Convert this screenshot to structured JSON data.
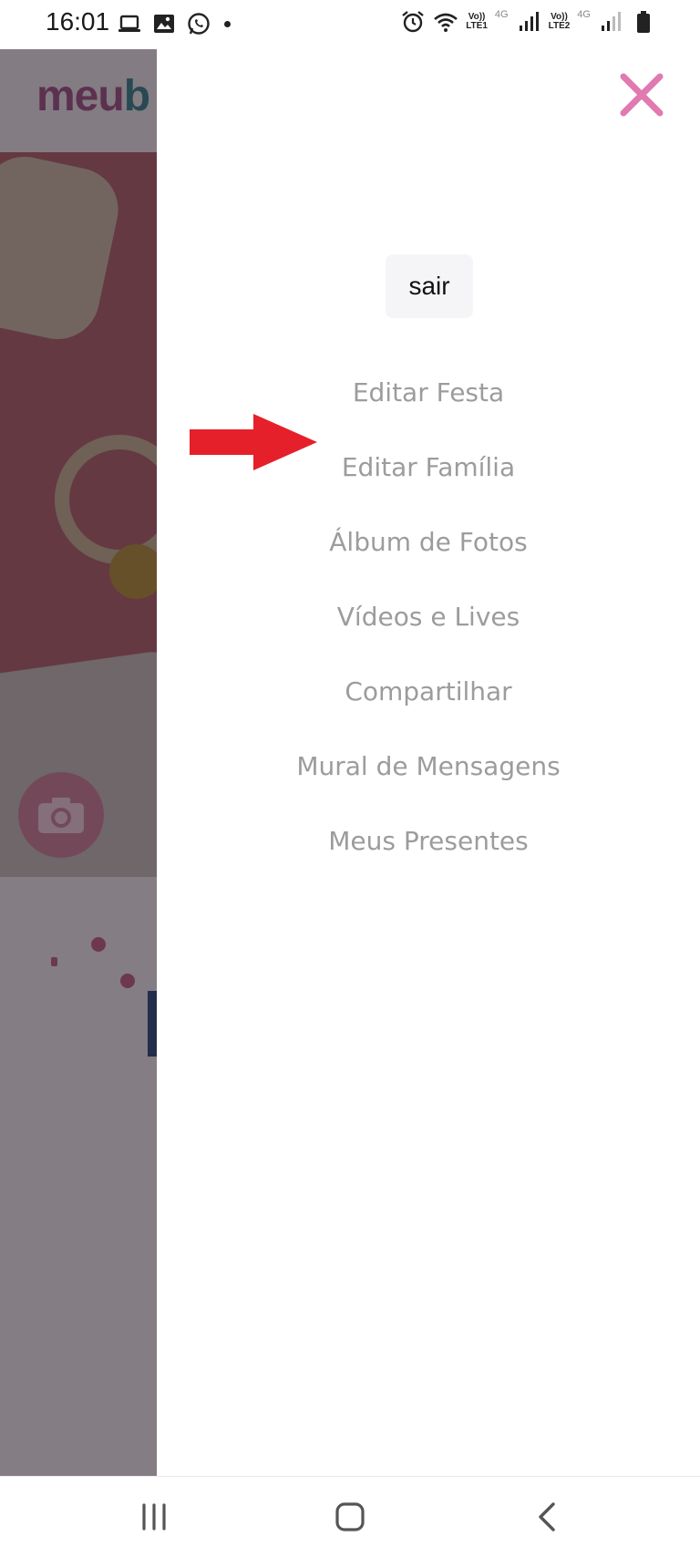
{
  "status_bar": {
    "time": "16:01",
    "sim1_label_top": "Vo))",
    "sim1_label_bottom": "LTE1",
    "sim2_label_top": "Vo))",
    "sim2_label_bottom": "LTE2",
    "network_type_1": "4G",
    "network_type_2": "4G",
    "left_icons": [
      "laptop-icon",
      "gallery-icon",
      "whatsapp-icon",
      "dot-icon"
    ],
    "right_icons": [
      "alarm-icon",
      "wifi-icon",
      "signal-icon",
      "signal-icon",
      "battery-icon"
    ]
  },
  "background_page": {
    "logo_text": "meu",
    "logo_partial": "b",
    "camera_icon": "camera-icon"
  },
  "drawer": {
    "close_icon": "close-icon",
    "close_color": "#e07ab0",
    "logout_label": "sair",
    "menu_items": [
      {
        "label": "Editar Festa"
      },
      {
        "label": "Editar Família"
      },
      {
        "label": "Álbum de Fotos"
      },
      {
        "label": "Vídeos e Lives"
      },
      {
        "label": "Compartilhar"
      },
      {
        "label": "Mural de Mensagens"
      },
      {
        "label": "Meus Presentes"
      }
    ],
    "menu_text_color": "#9c9c9c",
    "annotation_arrow_color": "#e5202a"
  },
  "nav_bar": {
    "buttons": [
      "recent-apps-icon",
      "home-icon",
      "back-icon"
    ]
  }
}
